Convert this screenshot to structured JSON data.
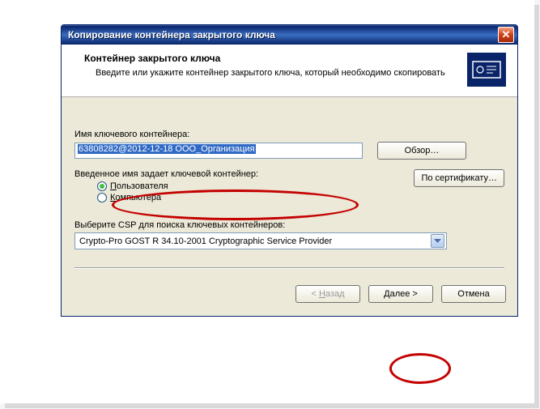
{
  "titlebar": {
    "title": "Копирование контейнера закрытого ключа"
  },
  "header": {
    "title": "Контейнер закрытого ключа",
    "desc": "Введите или укажите контейнер закрытого ключа, который необходимо скопировать"
  },
  "container": {
    "label": "Имя ключевого контейнера:",
    "value": "63808282@2012-12-18 ООО_Организация",
    "browse_btn": "Обзор…",
    "by_cert_btn": "По сертификату…"
  },
  "scope": {
    "label": "Введенное имя задает ключевой контейнер:",
    "user": "Пользователя",
    "user_u": "П",
    "computer": "Компьютера",
    "computer_u": "К",
    "selected": "user"
  },
  "csp": {
    "label": "Выберите CSP для поиска ключевых контейнеров:",
    "value": "Crypto-Pro GOST R 34.10-2001 Cryptographic Service Provider"
  },
  "footer": {
    "back": "< Назад",
    "back_u": "Н",
    "next": "Далее >",
    "next_u": "Д",
    "cancel": "Отмена"
  }
}
